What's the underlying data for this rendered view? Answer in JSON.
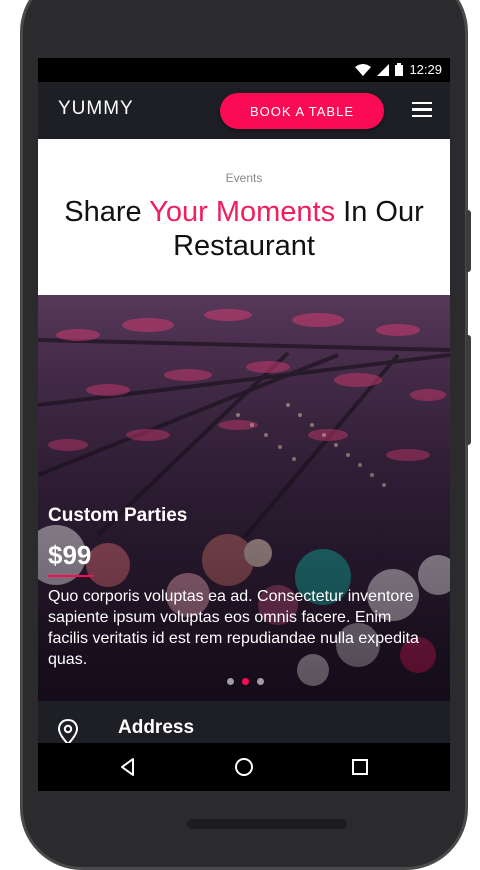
{
  "status": {
    "time": "12:29"
  },
  "appbar": {
    "brand": "YUMMY",
    "book_label": "BOOK A TABLE"
  },
  "events": {
    "eyebrow": "Events",
    "headline_pre": "Share ",
    "headline_accent": "Your Moments",
    "headline_post": " In Our Restaurant"
  },
  "slide": {
    "title": "Custom Parties",
    "price": "$99",
    "description": "Quo corporis voluptas ea ad. Consectetur inventore sapiente ipsum voluptas eos omnis facere. Enim facilis veritatis id est rem repudiandae nulla expedita quas.",
    "total": 3,
    "active": 2
  },
  "info": {
    "label": "Address"
  },
  "colors": {
    "accent": "#fb0b53",
    "appbar": "#1d1f25"
  },
  "icons": [
    "wifi-icon",
    "signal-icon",
    "battery-icon",
    "menu-icon",
    "location-pin-icon",
    "back-icon",
    "home-icon",
    "recents-icon"
  ]
}
